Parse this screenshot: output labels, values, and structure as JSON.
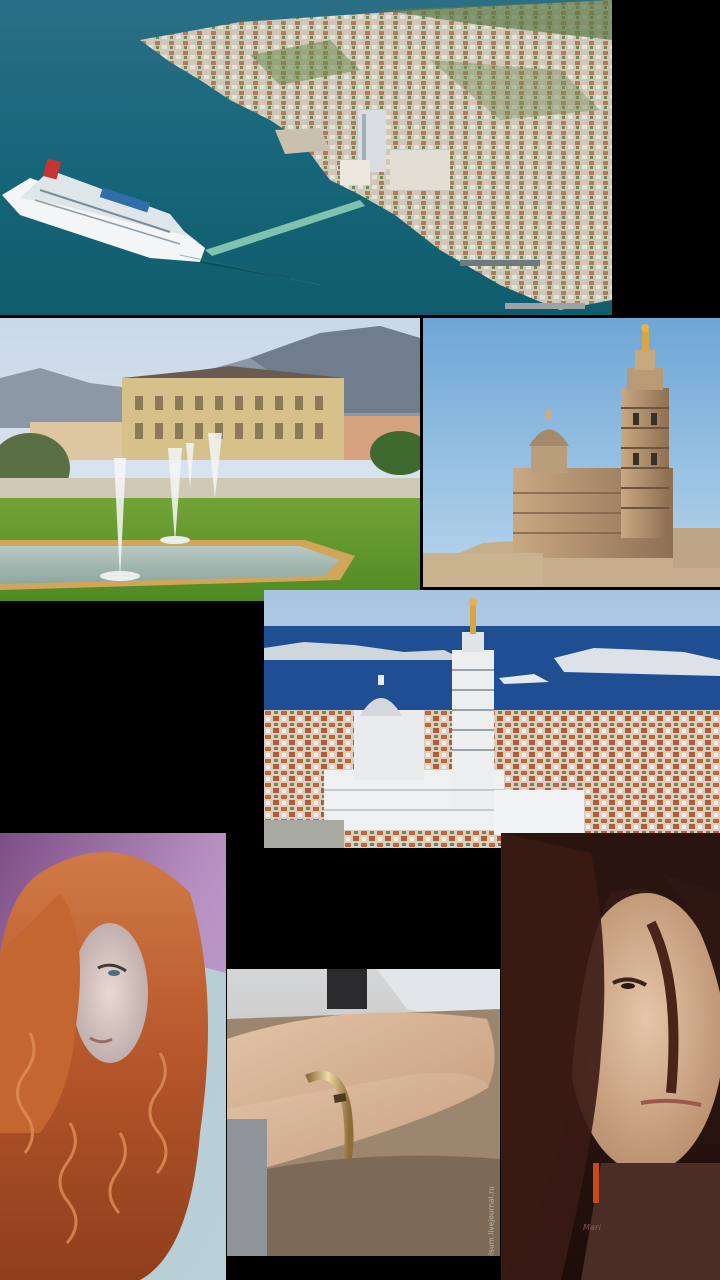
{
  "collage": {
    "background": "#000000",
    "tiles": [
      {
        "id": "harbor",
        "subject": "aerial-harbor-with-cruise-ship"
      },
      {
        "id": "palace",
        "subject": "palace-with-fountains"
      },
      {
        "id": "basilica",
        "subject": "hilltop-basilica"
      },
      {
        "id": "basilica-sea",
        "subject": "basilica-overlooking-sea-and-islands"
      },
      {
        "id": "redhead",
        "subject": "woman-with-curly-red-hair"
      },
      {
        "id": "bracelet",
        "subject": "wrist-with-gold-bracelet"
      },
      {
        "id": "man",
        "subject": "man-with-long-dark-hair"
      }
    ]
  },
  "watermark": {
    "text": "artdeisum.livejournal.ru"
  },
  "signature": {
    "text": "Mari"
  }
}
